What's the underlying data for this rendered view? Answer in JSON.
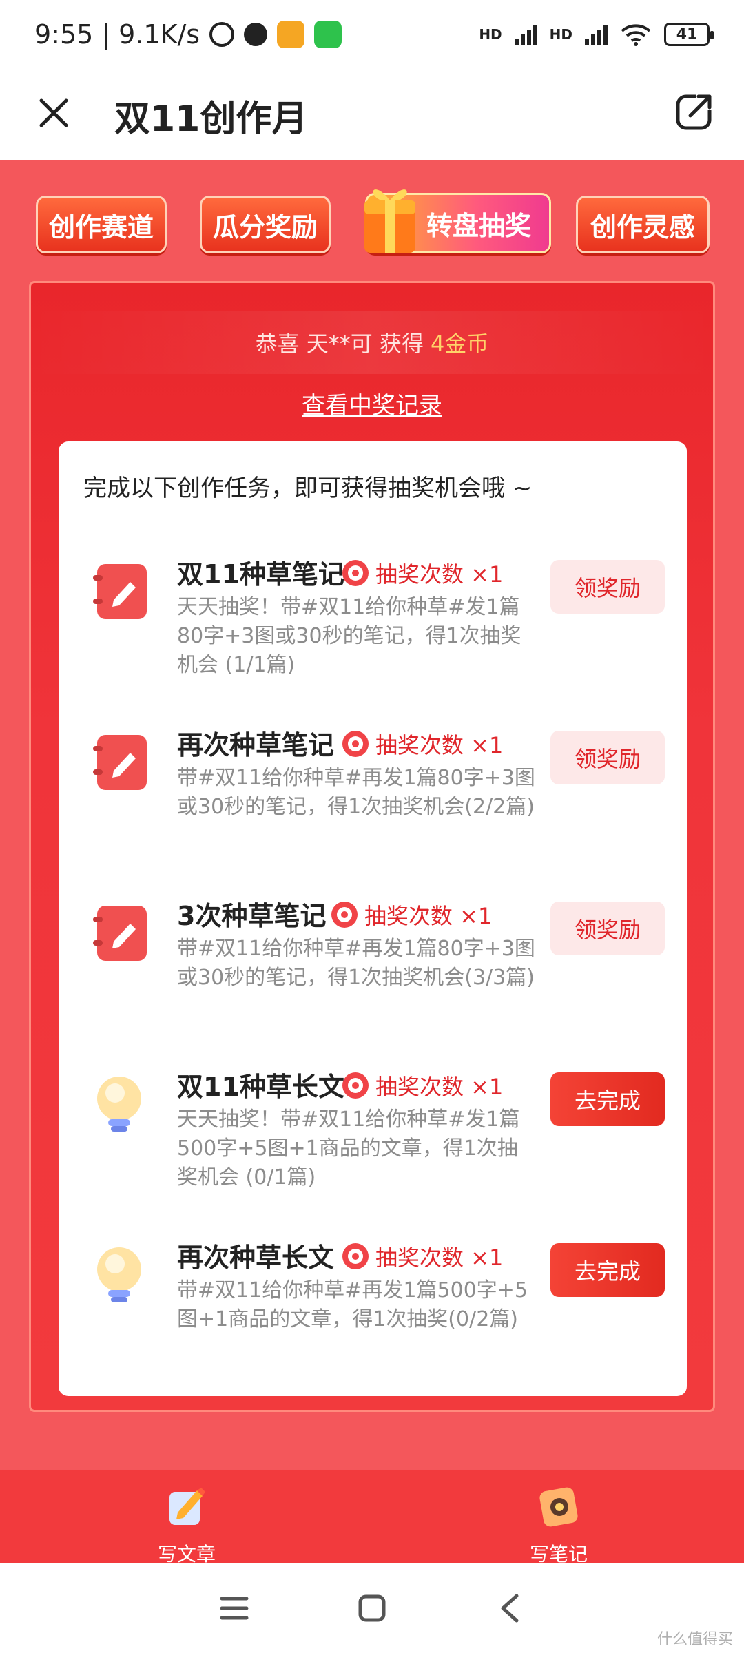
{
  "status_bar": {
    "time": "9:55",
    "speed": "9.1K/s",
    "battery": "41",
    "net_label": "HD"
  },
  "header": {
    "title": "双11创作月"
  },
  "tabs": [
    {
      "label": "创作赛道"
    },
    {
      "label": "瓜分奖励"
    },
    {
      "label": "转盘抽奖"
    },
    {
      "label": "创作灵感"
    }
  ],
  "winner": {
    "prefix": "恭喜 天**可 获得",
    "prize": "4金币"
  },
  "record_link": "查看中奖记录",
  "intro": "完成以下创作任务，即可获得抽奖机会哦 ~",
  "tasks": [
    {
      "title": "双11种草笔记",
      "badge": "抽奖次数 ×1",
      "desc": "天天抽奖！带#双11给你种草#发1篇80字+3图或30秒的笔记，得1次抽奖机会 (1/1篇)",
      "button": "领奖励"
    },
    {
      "title": "再次种草笔记",
      "badge": "抽奖次数 ×1",
      "desc": "带#双11给你种草#再发1篇80字+3图或30秒的笔记，得1次抽奖机会(2/2篇)",
      "button": "领奖励"
    },
    {
      "title": "3次种草笔记",
      "badge": "抽奖次数 ×1",
      "desc": "带#双11给你种草#再发1篇80字+3图或30秒的笔记，得1次抽奖机会(3/3篇)",
      "button": "领奖励"
    },
    {
      "title": "双11种草长文",
      "badge": "抽奖次数 ×1",
      "desc": "天天抽奖！带#双11给你种草#发1篇500字+5图+1商品的文章，得1次抽奖机会 (0/1篇)",
      "button": "去完成"
    },
    {
      "title": "再次种草长文",
      "badge": "抽奖次数 ×1",
      "desc": "带#双11给你种草#再发1篇500字+5图+1商品的文章，得1次抽奖(0/2篇)",
      "button": "去完成"
    }
  ],
  "bottom_actions": [
    {
      "label": "写文章"
    },
    {
      "label": "写笔记"
    }
  ],
  "watermark": "什么值得买",
  "colors": {
    "brand_red": "#f23a3d",
    "accent_gold": "#ffd36a"
  }
}
